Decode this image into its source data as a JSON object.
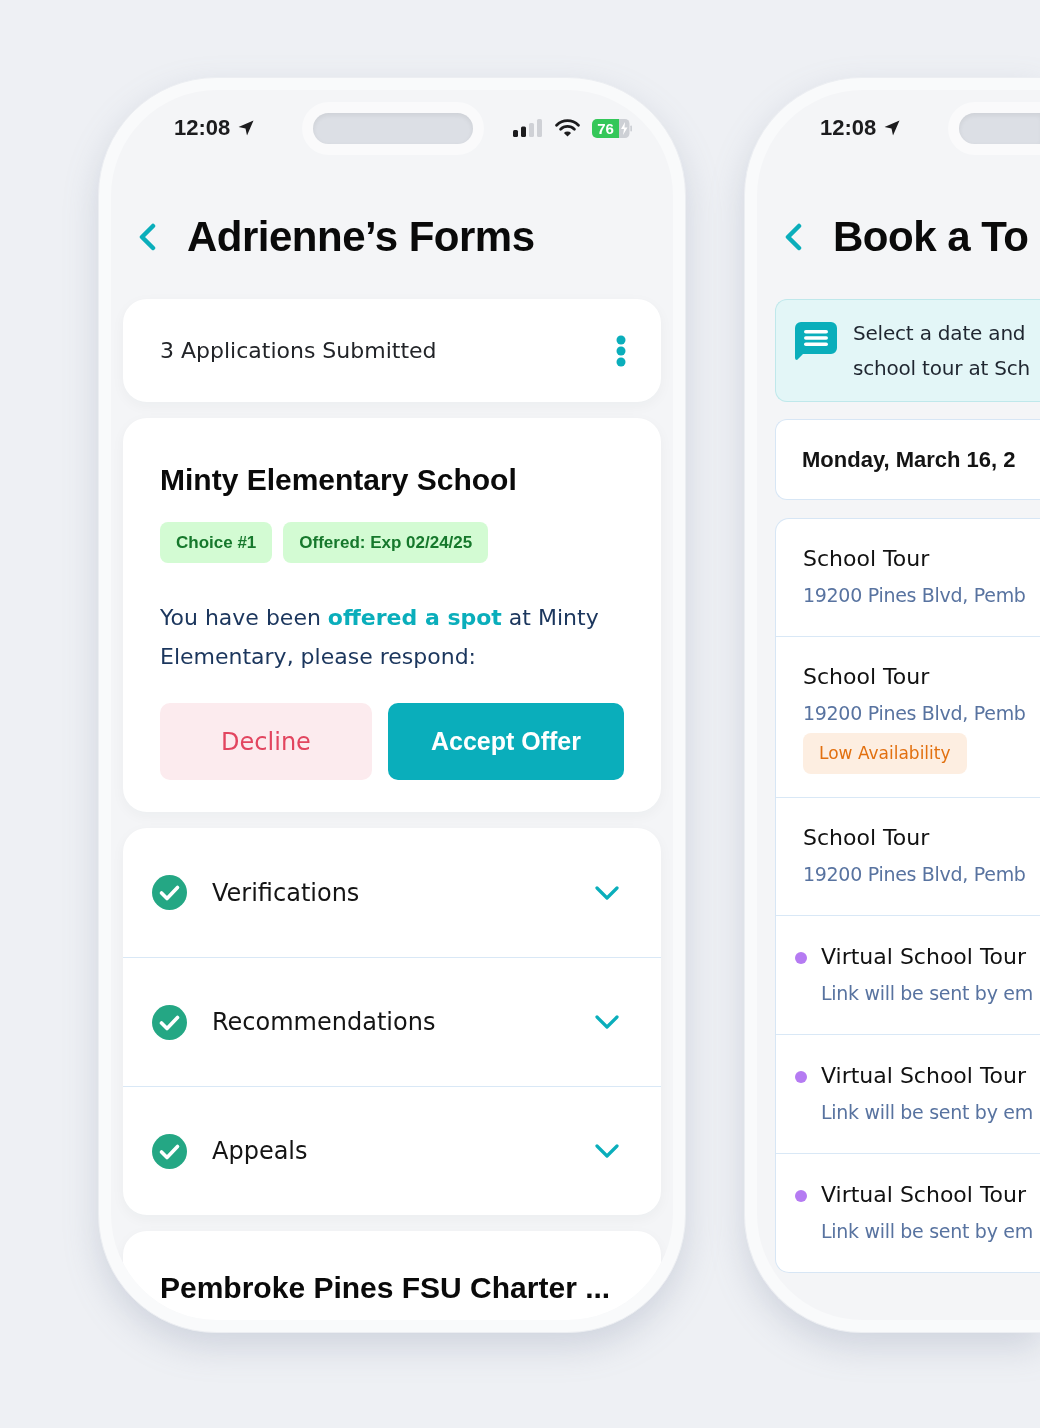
{
  "forms_screen": {
    "status_bar": {
      "time": "12:08",
      "battery": "76"
    },
    "title": "Adrienne’s Forms",
    "summary": "3 Applications Submitted",
    "applications": [
      {
        "school": "Minty Elementary School",
        "tags": [
          "Choice #1",
          "Offered: Exp 02/24/25"
        ],
        "message": "You have been **offered a spot** at Minty Elementary, please respond:",
        "actions": [
          {
            "label": "Decline",
            "kind": "decline"
          },
          {
            "label": "Accept Offer",
            "kind": "accept"
          }
        ],
        "sections": [
          {
            "label": "Verifications",
            "checked": true,
            "expanded": false
          },
          {
            "label": "Recommendations",
            "checked": true,
            "expanded": false
          },
          {
            "label": "Appeals",
            "checked": true,
            "expanded": false
          }
        ]
      },
      {
        "school": "Pembroke Pines FSU Charter ..."
      }
    ]
  },
  "tour_screen": {
    "status_bar": {
      "time": "12:08"
    },
    "title": "Book a To",
    "info_lines": [
      "Select a date and",
      "school tour at Sch"
    ],
    "date": "Monday, March 16, 2",
    "tours": [
      {
        "kind": "in_person",
        "title": "School Tour",
        "subtitle": "19200 Pines Blvd, Pemb"
      },
      {
        "kind": "in_person",
        "title": "School Tour",
        "subtitle": "19200 Pines Blvd, Pemb",
        "badge": {
          "text": "Low Availability",
          "kind": "warning"
        }
      },
      {
        "kind": "in_person",
        "title": "School Tour",
        "subtitle": "19200 Pines Blvd, Pemb"
      },
      {
        "kind": "virtual",
        "title": "Virtual School Tour",
        "subtitle": "Link will be sent by em",
        "color": "#b57bf2"
      },
      {
        "kind": "virtual",
        "title": "Virtual School Tour",
        "subtitle": "Link will be sent by em",
        "color": "#b57bf2"
      },
      {
        "kind": "virtual",
        "title": "Virtual School Tour",
        "subtitle": "Link will be sent by em",
        "color": "#b57bf2"
      }
    ]
  }
}
